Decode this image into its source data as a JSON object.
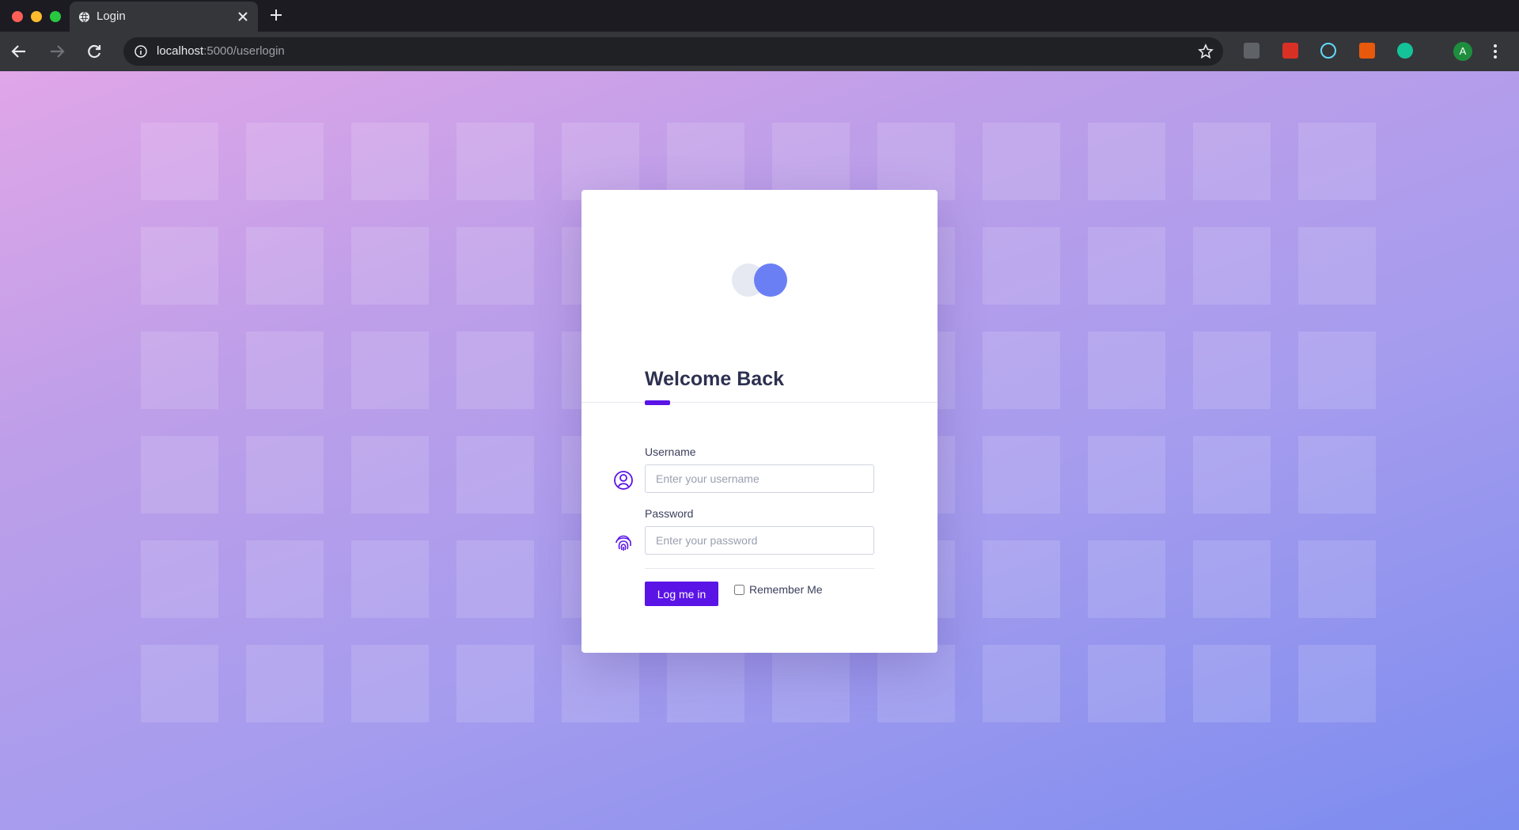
{
  "browser": {
    "tab_title": "Login",
    "url_host": "localhost",
    "url_rest": ":5000/userlogin",
    "avatar_letter": "A",
    "extensions": [
      "off-extension-icon",
      "arrow-extension-icon",
      "react-devtools-icon",
      "pdf-extension-icon",
      "grammarly-icon"
    ]
  },
  "login": {
    "title": "Welcome Back",
    "username_label": "Username",
    "username_placeholder": "Enter your username",
    "password_label": "Password",
    "password_placeholder": "Enter your password",
    "submit_label": "Log me in",
    "remember_label": "Remember Me"
  },
  "colors": {
    "accent": "#5b14e6",
    "logo_primary": "#6b7ff5",
    "logo_secondary": "#e6e9f2"
  }
}
